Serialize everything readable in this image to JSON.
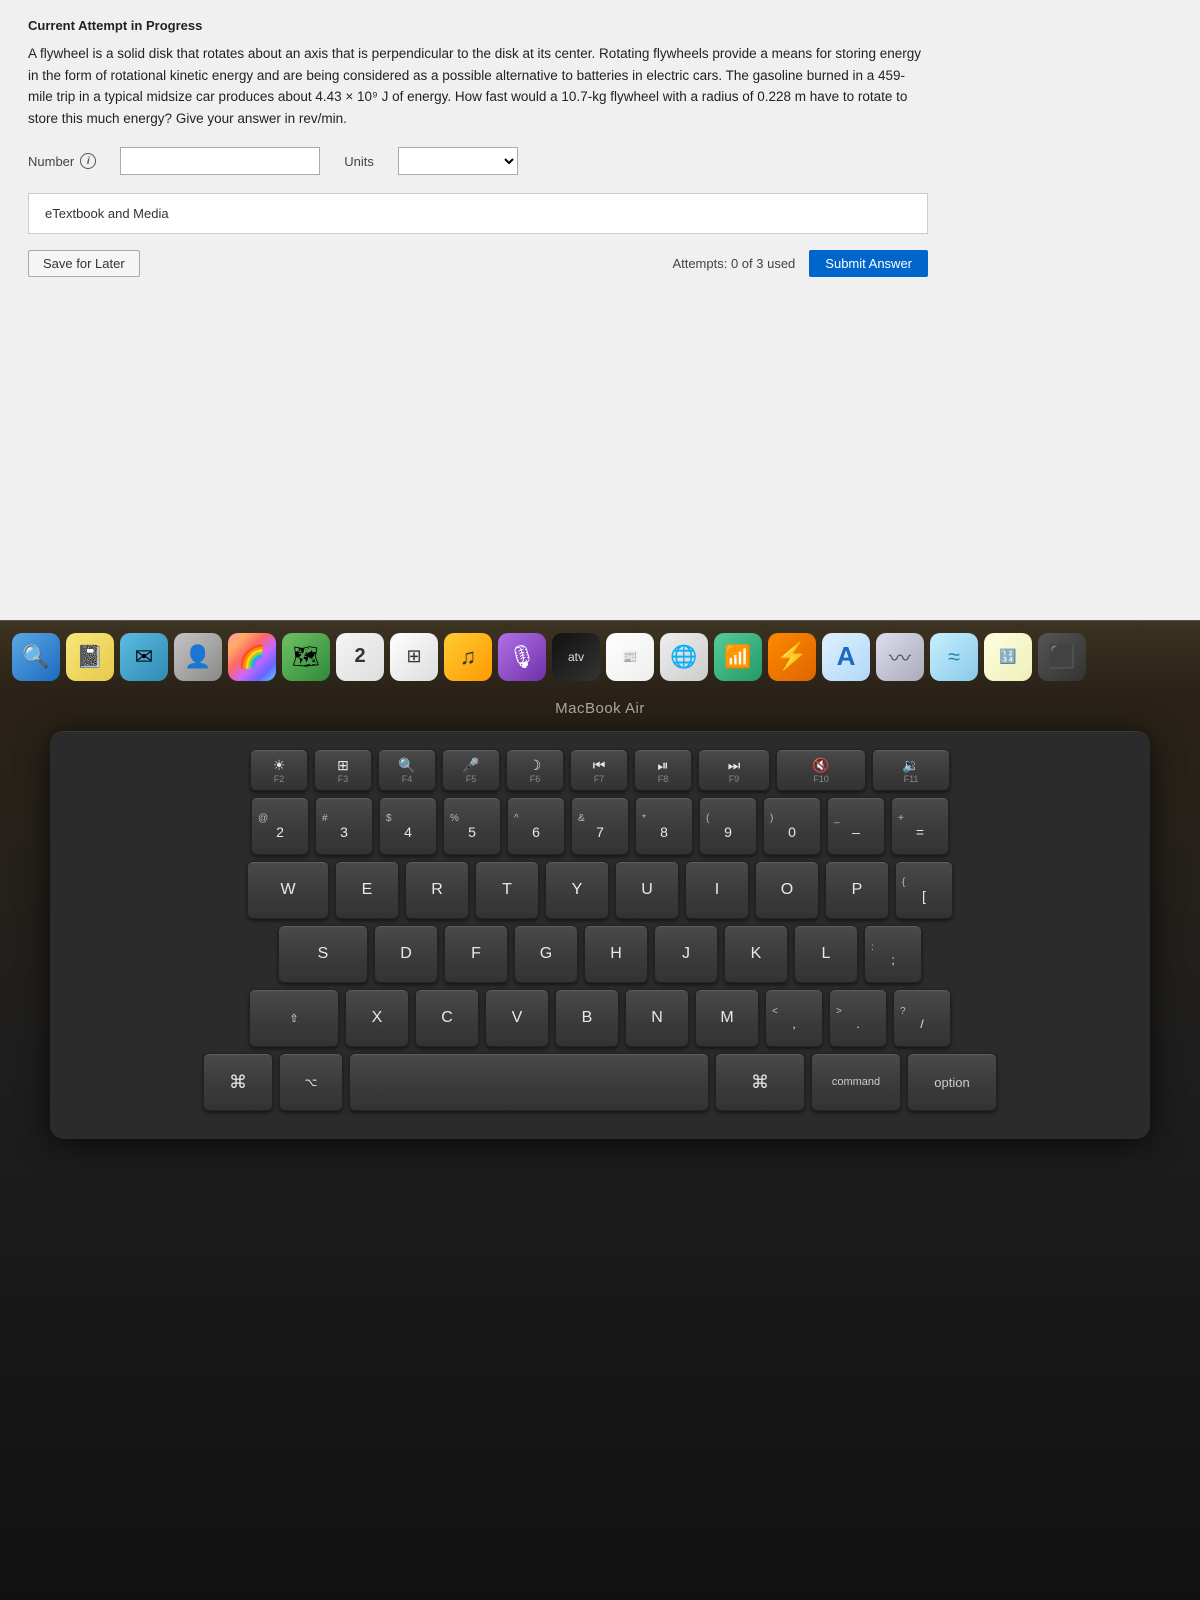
{
  "page": {
    "attempt_label": "Current Attempt in Progress",
    "question_text": "A flywheel is a solid disk that rotates about an axis that is perpendicular to the disk at its center. Rotating flywheels provide a means for storing energy in the form of rotational kinetic energy and are being considered as a possible alternative to batteries in electric cars. The gasoline burned in a 459-mile trip in a typical midsize car produces about 4.43 × 10⁹ J of energy. How fast would a 10.7-kg flywheel with a radius of 0.228 m have to rotate to store this much energy? Give your answer in rev/min.",
    "number_label": "Number",
    "units_label": "Units",
    "info_icon": "i",
    "number_placeholder": "",
    "etextbook_label": "eTextbook and Media",
    "save_later_label": "Save for Later",
    "attempts_text": "Attempts: 0 of 3 used",
    "submit_label": "Submit Answer",
    "macbook_label": "MacBook Air",
    "dock_icons": [
      "🔍",
      "📝",
      "✉️",
      "👤",
      "🖼️",
      "🗺️",
      "2",
      "🕐",
      "🎵",
      "🎙️",
      "📺",
      "📰",
      "🌐",
      "📊",
      "⚡",
      "A",
      "〰️",
      "≈",
      "🔢",
      "⬛"
    ],
    "keyboard": {
      "fn_row": [
        {
          "label": "F2",
          "icon": "☀"
        },
        {
          "label": "F3",
          "icon": "⊞"
        },
        {
          "label": "F4",
          "icon": "🔍"
        },
        {
          "label": "F5",
          "icon": "🎤"
        },
        {
          "label": "F6",
          "icon": "☽"
        },
        {
          "label": "F7",
          "icon": "⏮"
        },
        {
          "label": "F8",
          "icon": "⏯"
        },
        {
          "label": "F9",
          "icon": "⏭"
        },
        {
          "label": "F10",
          "icon": "🔇"
        },
        {
          "label": "F11",
          "icon": "🔉"
        }
      ],
      "row_num": [
        {
          "top": "@",
          "bot": "2",
          "fn": ""
        },
        {
          "top": "#",
          "bot": "3",
          "fn": ""
        },
        {
          "top": "$",
          "bot": "4",
          "fn": ""
        },
        {
          "top": "%",
          "bot": "5",
          "fn": ""
        },
        {
          "top": "^",
          "bot": "6",
          "fn": ""
        },
        {
          "top": "&",
          "bot": "7",
          "fn": ""
        },
        {
          "top": "*",
          "bot": "8",
          "fn": ""
        },
        {
          "top": "(",
          "bot": "9",
          "fn": ""
        },
        {
          "top": ")",
          "bot": "0",
          "fn": ""
        }
      ],
      "row_qwerty": [
        "W",
        "E",
        "R",
        "T",
        "Y",
        "U",
        "I",
        "O",
        "P"
      ],
      "row_asdf": [
        "S",
        "D",
        "F",
        "G",
        "H",
        "J",
        "K",
        "L"
      ],
      "row_zxcv": [
        "X",
        "C",
        "V",
        "B",
        "N",
        "M"
      ],
      "bottom_keys": {
        "command_sym": "⌘",
        "command_label": "command",
        "option_label": "option"
      }
    }
  }
}
